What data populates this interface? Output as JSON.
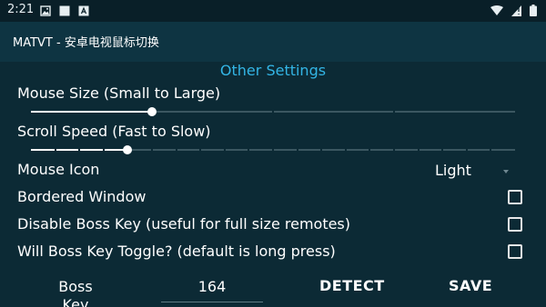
{
  "status_bar": {
    "time": "2:21",
    "icons_left": [
      "image-icon",
      "square-icon",
      "font-icon"
    ],
    "icons_right": [
      "wifi-icon",
      "signal-icon",
      "battery-icon"
    ]
  },
  "app_bar": {
    "title": "MATVT - 安卓电视鼠标切换"
  },
  "settings": {
    "section_title": "Other Settings",
    "mouse_size": {
      "label": "Mouse Size (Small to Large)",
      "value_fraction": 0.25,
      "steps": 4
    },
    "scroll_speed": {
      "label": "Scroll Speed (Fast to Slow)",
      "value_fraction": 0.2,
      "steps": 20
    },
    "mouse_icon": {
      "label": "Mouse Icon",
      "selected": "Light"
    },
    "bordered_window": {
      "label": "Bordered Window",
      "checked": false
    },
    "disable_boss_key": {
      "label": "Disable Boss Key (useful for full size remotes)",
      "checked": false
    },
    "boss_key_toggle": {
      "label": "Will Boss Key Toggle? (default is long press)",
      "checked": false
    }
  },
  "boss_key": {
    "label": "Boss Key",
    "value": "164",
    "detect_label": "DETECT",
    "save_label": "SAVE"
  },
  "colors": {
    "accent": "#33b5e5",
    "background": "#0c2a35",
    "app_bar": "#0e3442",
    "status_bar": "#091f28"
  }
}
